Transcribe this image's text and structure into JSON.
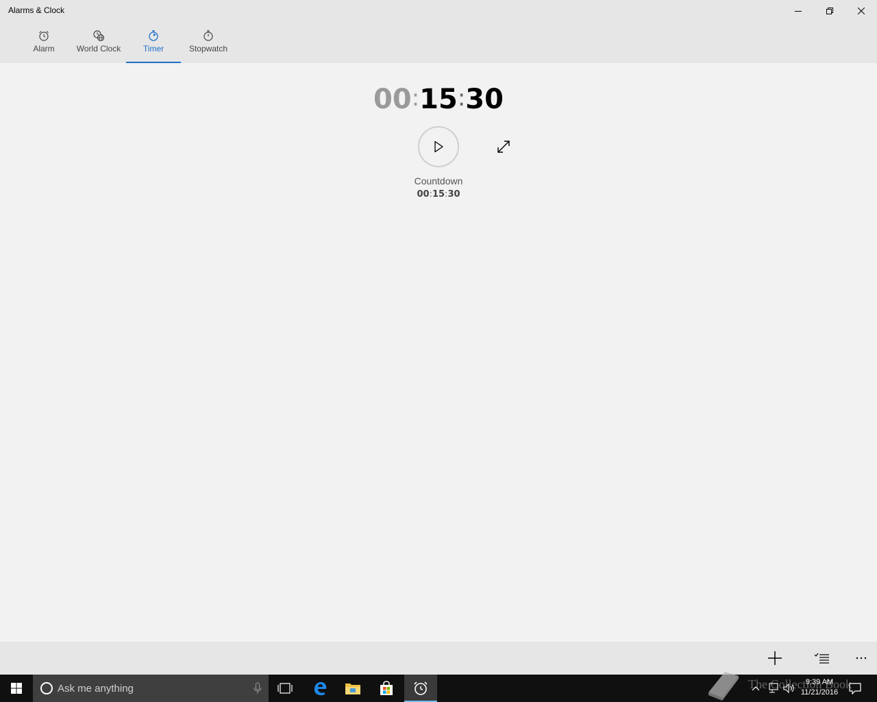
{
  "window": {
    "title": "Alarms & Clock"
  },
  "tabs": [
    {
      "label": "Alarm",
      "icon": "alarm-clock-icon"
    },
    {
      "label": "World Clock",
      "icon": "world-clock-icon"
    },
    {
      "label": "Timer",
      "icon": "timer-icon",
      "active": true
    },
    {
      "label": "Stopwatch",
      "icon": "stopwatch-icon"
    }
  ],
  "timer": {
    "hours": "00",
    "minutes": "15",
    "seconds": "30",
    "name": "Countdown",
    "small_hours": "00",
    "small_minutes": "15",
    "small_seconds": "30"
  },
  "commands": {
    "add": "add-icon",
    "select": "select-list-icon",
    "more": "more-icon"
  },
  "taskbar": {
    "search_placeholder": "Ask me anything",
    "time": "9:39 AM",
    "date": "11/21/2016"
  },
  "watermark": {
    "text": "The Collection Book"
  },
  "colors": {
    "accent": "#1f6fc9",
    "taskbar": "#101010",
    "chrome": "#e6e6e6",
    "background": "#f2f2f2"
  }
}
